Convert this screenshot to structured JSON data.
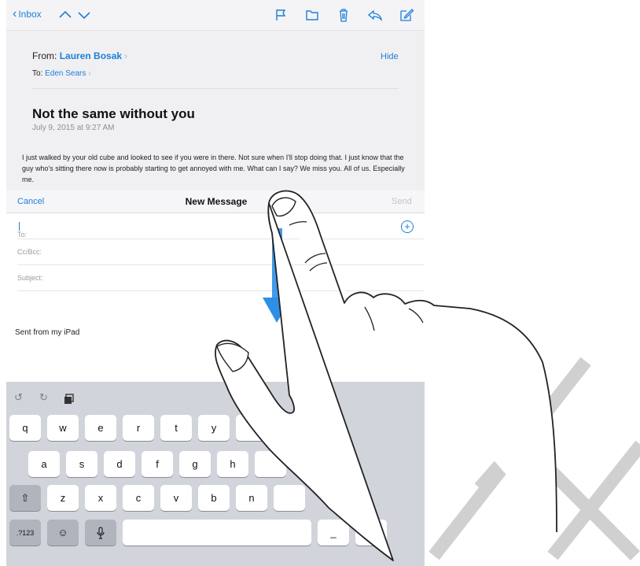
{
  "mail": {
    "back_label": "Inbox",
    "from_label": "From:",
    "from_name": "Lauren Bosak",
    "to_label": "To:",
    "to_name": "Eden Sears",
    "hide_label": "Hide",
    "subject": "Not the same without you",
    "date": "July 9, 2015 at 9:27 AM",
    "body": "I just walked by your old cube and looked to see if you were in there. Not sure when I'll stop doing that. I just know that the guy who's sitting there now is probably starting to get annoyed with me. What can I say? We miss you. All of us. Especially me.",
    "toolbar_icons": [
      "chevron-up-icon",
      "chevron-down-icon",
      "flag-icon",
      "folder-icon",
      "trash-icon",
      "reply-icon",
      "compose-icon"
    ]
  },
  "compose": {
    "cancel_label": "Cancel",
    "title": "New Message",
    "send_label": "Send",
    "to_label": "To:",
    "cc_label": "Cc/Bcc:",
    "subject_label": "Subject:",
    "signature": "Sent from my iPad"
  },
  "keyboard": {
    "row1": [
      "q",
      "w",
      "e",
      "r",
      "t",
      "y"
    ],
    "row2": [
      "a",
      "s",
      "d",
      "f",
      "g",
      "h"
    ],
    "row3": [
      "z",
      "x",
      "c",
      "v",
      "b",
      "n"
    ],
    "numbers_label": ".?123",
    "space_label": "",
    "extra_key_label": "_"
  },
  "colors": {
    "accent": "#1d7fd8",
    "gesture_arrow": "#2e8fe6",
    "watermark": "#d0d0d0"
  }
}
